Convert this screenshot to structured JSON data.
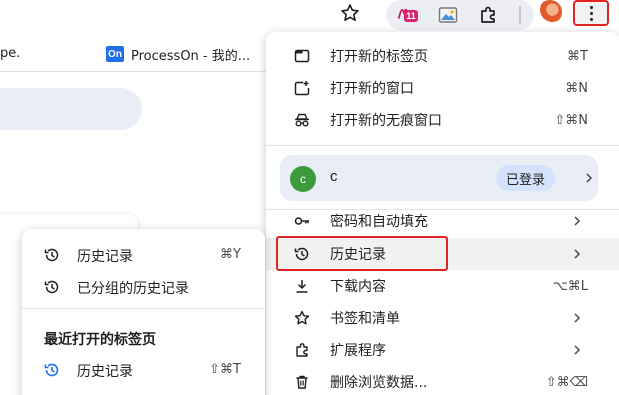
{
  "bookmarks_bar": {
    "left_truncated": "pe.",
    "item_favicon": "On",
    "item_label": "ProcessOn - 我的..."
  },
  "toolbar": {
    "extension_badge": "11"
  },
  "main_menu": {
    "items_top": [
      {
        "label": "打开新的标签页",
        "shortcut": "⌘T",
        "icon": "new-tab-icon"
      },
      {
        "label": "打开新的窗口",
        "shortcut": "⌘N",
        "icon": "new-window-icon"
      },
      {
        "label": "打开新的无痕窗口",
        "shortcut": "⇧⌘N",
        "icon": "incognito-icon"
      }
    ],
    "profile": {
      "avatar_letter": "c",
      "name": "c",
      "status": "已登录"
    },
    "items_bottom": [
      {
        "label": "密码和自动填充",
        "shortcut": "",
        "icon": "key-icon",
        "has_submenu": true
      },
      {
        "label": "历史记录",
        "shortcut": "",
        "icon": "history-icon",
        "has_submenu": true
      },
      {
        "label": "下载内容",
        "shortcut": "⌥⌘L",
        "icon": "download-icon",
        "has_submenu": false
      },
      {
        "label": "书签和清单",
        "shortcut": "",
        "icon": "star-icon",
        "has_submenu": true
      },
      {
        "label": "扩展程序",
        "shortcut": "",
        "icon": "puzzle-icon",
        "has_submenu": true
      },
      {
        "label": "删除浏览数据...",
        "shortcut": "⇧⌘⌫",
        "icon": "trash-icon",
        "has_submenu": false
      }
    ]
  },
  "history_submenu": {
    "items": [
      {
        "label": "历史记录",
        "shortcut": "⌘Y",
        "icon": "history-icon"
      },
      {
        "label": "已分组的历史记录",
        "shortcut": "",
        "icon": "history-icon"
      }
    ],
    "recent_heading": "最近打开的标签页",
    "recent_items": [
      {
        "label": "历史记录",
        "shortcut": "⇧⌘T",
        "icon": "history-blue-icon"
      }
    ]
  },
  "colors": {
    "highlight_border": "#e02424",
    "profile_row_bg": "#e9eef6",
    "signed_in_badge_bg": "#d3e3fd",
    "avatar_green": "#3c9a3c",
    "accent_blue": "#1a73e8"
  }
}
